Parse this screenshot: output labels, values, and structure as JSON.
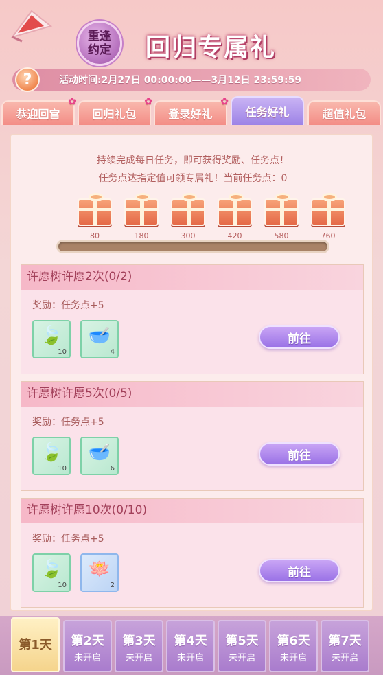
{
  "header": {
    "seal_text": "重逢约定",
    "title": "回归专属礼",
    "activity_time": "活动时间:2月27日 00:00:00——3月12日 23:59:59",
    "help_label": "?"
  },
  "tabs": [
    {
      "label": "恭迎回宫",
      "active": false
    },
    {
      "label": "回归礼包",
      "active": false
    },
    {
      "label": "登录好礼",
      "active": false
    },
    {
      "label": "任务好礼",
      "active": true
    },
    {
      "label": "超值礼包",
      "active": false
    }
  ],
  "intro": {
    "line1": "持续完成每日任务，即可获得奖励、任务点！",
    "line2": "任务点达指定值可领专属礼！当前任务点：0"
  },
  "milestones": [
    {
      "label": "80"
    },
    {
      "label": "180"
    },
    {
      "label": "300"
    },
    {
      "label": "420"
    },
    {
      "label": "580"
    },
    {
      "label": "760"
    }
  ],
  "progress": {
    "current": 0,
    "max": 760
  },
  "tasks": [
    {
      "title": "许愿树许愿2次(0/2)",
      "reward": "奖励：任务点+5",
      "items": [
        {
          "icon": "silver-leaf-icon",
          "count": "10",
          "color": "green"
        },
        {
          "icon": "pearl-dish-icon",
          "count": "4",
          "color": "green"
        }
      ],
      "button": "前往"
    },
    {
      "title": "许愿树许愿5次(0/5)",
      "reward": "奖励：任务点+5",
      "items": [
        {
          "icon": "silver-leaf-icon",
          "count": "10",
          "color": "green"
        },
        {
          "icon": "pearl-dish-icon",
          "count": "6",
          "color": "green"
        }
      ],
      "button": "前往"
    },
    {
      "title": "许愿树许愿10次(0/10)",
      "reward": "奖励：任务点+5",
      "items": [
        {
          "icon": "silver-leaf-icon",
          "count": "10",
          "color": "green"
        },
        {
          "icon": "lotus-leaf-icon",
          "count": "2",
          "color": "blue"
        }
      ],
      "button": "前往"
    }
  ],
  "days": [
    {
      "label": "第1天",
      "status": "",
      "active": true
    },
    {
      "label": "第2天",
      "status": "未开启",
      "active": false
    },
    {
      "label": "第3天",
      "status": "未开启",
      "active": false
    },
    {
      "label": "第4天",
      "status": "未开启",
      "active": false
    },
    {
      "label": "第5天",
      "status": "未开启",
      "active": false
    },
    {
      "label": "第6天",
      "status": "未开启",
      "active": false
    },
    {
      "label": "第7天",
      "status": "未开启",
      "active": false
    }
  ],
  "colors": {
    "accent_purple": "#9a72e6",
    "tab_pink": "#f38d86",
    "title_pink": "#c24d74"
  }
}
